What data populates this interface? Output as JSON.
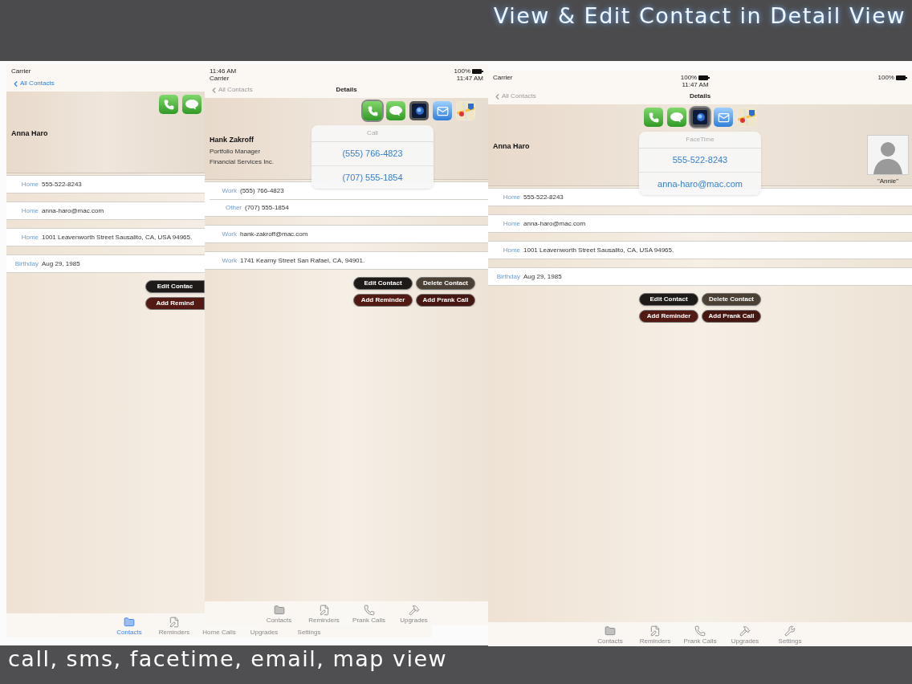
{
  "headline": "View & Edit Contact in Detail View",
  "screens": [
    {
      "status": {
        "left": [
          {
            "text": "Carrier",
            "battery": false
          }
        ]
      },
      "nav": {
        "back": "All Contacts",
        "dimmed": false
      },
      "actions": [
        {
          "kind": "phone",
          "selected": false
        },
        {
          "kind": "sms",
          "selected": false
        }
      ],
      "name": "Anna Haro",
      "groups": [
        [
          {
            "label": "Home",
            "value": "555-522-8243"
          }
        ],
        [
          {
            "label": "Home",
            "value": "anna-haro@mac.com"
          }
        ],
        [
          {
            "label": "Home",
            "value": "1001  Leavenworth Street Sausalito, CA, USA 94965."
          }
        ],
        [
          {
            "label": "Birthday",
            "value": "Aug 29, 1985"
          }
        ]
      ],
      "buttons": [
        {
          "label": "Edit Contac",
          "color": "#1e1a18"
        },
        {
          "label": "Add Remind",
          "color": "#531a14"
        }
      ],
      "tabs": [
        {
          "label": "Contacts",
          "kind": "contacts",
          "selected": true
        },
        {
          "label": "Reminders",
          "kind": "reminders",
          "selected": false
        },
        {
          "label": "Home Calls",
          "selected": false
        },
        {
          "label": "Upgrades",
          "selected": false
        },
        {
          "label": "Settings",
          "selected": false
        }
      ]
    },
    {
      "status": {
        "left": [
          {
            "text": "11:46 AM",
            "battery": false
          },
          {
            "text": "Carrier",
            "battery": false
          }
        ],
        "right": [
          {
            "text": "100%",
            "battery": true
          },
          {
            "text": "11:47 AM",
            "battery": false
          }
        ]
      },
      "nav": {
        "back": "All Contacts",
        "title": "Details",
        "dimmed": true
      },
      "actions": [
        {
          "kind": "phone",
          "selected": true
        },
        {
          "kind": "sms",
          "selected": false
        },
        {
          "kind": "facetime",
          "selected": false
        },
        {
          "kind": "mail",
          "selected": false
        },
        {
          "kind": "map",
          "selected": false
        }
      ],
      "popover": {
        "title": "Call",
        "options": [
          "(555) 766-4823",
          "(707) 555-1854"
        ]
      },
      "name": "Hank Zakroff",
      "lines": [
        "Portfolio Manager",
        "Financial Services Inc."
      ],
      "groups": [
        [
          {
            "label": "Work",
            "value": "(555) 766-4823"
          },
          {
            "label": "Other",
            "value": "(707) 555-1854"
          }
        ],
        [
          {
            "label": "Work",
            "value": "hank-zakroff@mac.com"
          }
        ],
        [
          {
            "label": "Work",
            "value": "1741 Kearny Street San Rafael, CA, 94901."
          }
        ]
      ],
      "buttons": [
        {
          "label": "Edit Contact",
          "color": "#1e1a18"
        },
        {
          "label": "Delete Contact",
          "color": "#4a4036"
        },
        {
          "label": "Add Reminder",
          "color": "#531a14"
        },
        {
          "label": "Add Prank Call",
          "color": "#461612"
        }
      ],
      "tabs": [
        {
          "label": "Contacts",
          "kind": "contacts",
          "selected": false
        },
        {
          "label": "Reminders",
          "kind": "reminders",
          "selected": false
        },
        {
          "label": "Prank Calls",
          "kind": "calls",
          "selected": false
        },
        {
          "label": "Upgrades",
          "kind": "upgrades",
          "selected": false
        }
      ]
    },
    {
      "status": {
        "left": [
          {
            "text": "Carrier",
            "battery": false
          }
        ],
        "center": [
          {
            "text": "100%",
            "battery": true
          },
          {
            "text": "11:47 AM",
            "battery": false
          }
        ],
        "right": [
          {
            "text": "100%",
            "battery": true
          }
        ]
      },
      "nav": {
        "back": "All Contacts",
        "title": "Details",
        "dimmed": true
      },
      "actions": [
        {
          "kind": "phone",
          "selected": false
        },
        {
          "kind": "sms",
          "selected": false
        },
        {
          "kind": "facetime",
          "selected": true
        },
        {
          "kind": "mail",
          "selected": false
        },
        {
          "kind": "map",
          "selected": false
        }
      ],
      "popover": {
        "title": "FaceTime",
        "options": [
          "555-522-8243",
          "anna-haro@mac.com"
        ]
      },
      "name": "Anna Haro",
      "photo": {
        "caption": "\"Annie\""
      },
      "groups": [
        [
          {
            "label": "Home",
            "value": "555-522-8243"
          }
        ],
        [
          {
            "label": "Home",
            "value": "anna-haro@mac.com"
          }
        ],
        [
          {
            "label": "Home",
            "value": "1001  Leavenworth Street Sausalito, CA, USA 94965."
          }
        ],
        [
          {
            "label": "Birthday",
            "value": "Aug 29, 1985"
          }
        ]
      ],
      "buttons": [
        {
          "label": "Edit Contact",
          "color": "#1e1a18"
        },
        {
          "label": "Delete Contact",
          "color": "#4a4036"
        },
        {
          "label": "Add Reminder",
          "color": "#531a14"
        },
        {
          "label": "Add Prank Call",
          "color": "#461612"
        }
      ],
      "tabs": [
        {
          "label": "Contacts",
          "kind": "contacts",
          "selected": false
        },
        {
          "label": "Reminders",
          "kind": "reminders",
          "selected": false
        },
        {
          "label": "Prank Calls",
          "kind": "calls",
          "selected": false
        },
        {
          "label": "Upgrades",
          "kind": "upgrades",
          "selected": false
        },
        {
          "label": "Settings",
          "kind": "settings",
          "selected": false
        }
      ]
    }
  ],
  "caption": "call, sms, facetime, email, map view"
}
